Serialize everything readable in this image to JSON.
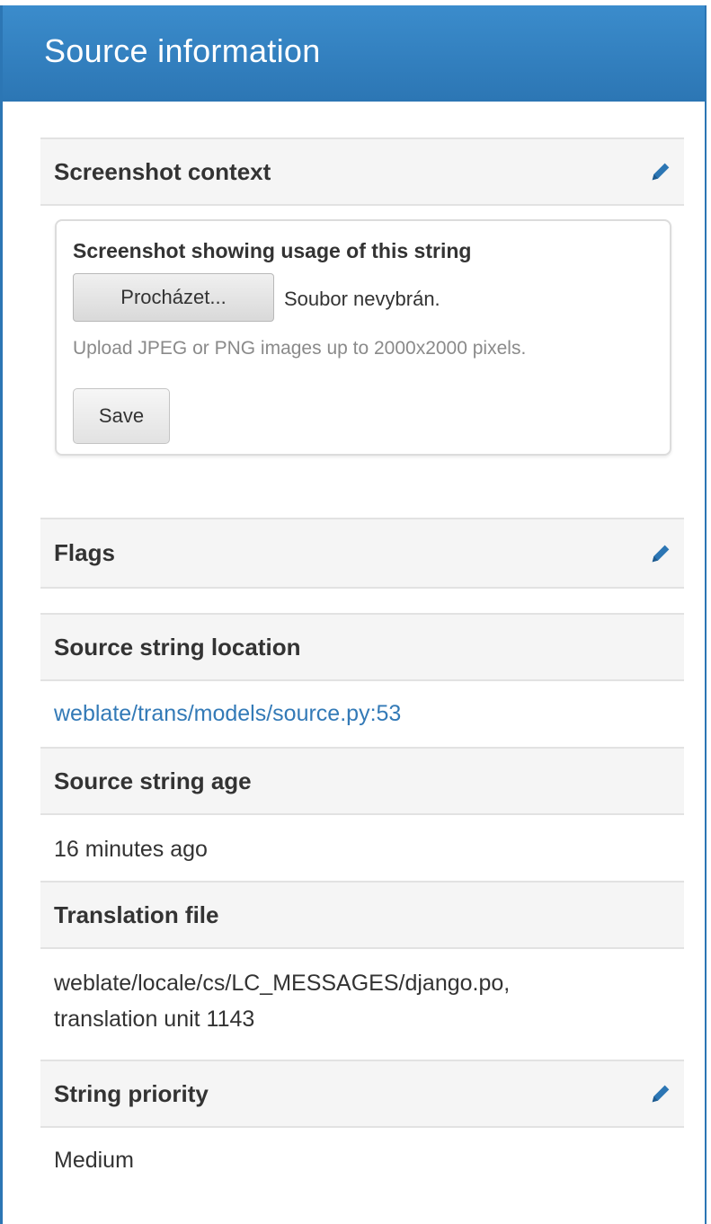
{
  "panel": {
    "title": "Source information"
  },
  "screenshot": {
    "header": "Screenshot context",
    "field_label": "Screenshot showing usage of this string",
    "browse_label": "Procházet...",
    "file_status": "Soubor nevybrán.",
    "help_text": "Upload JPEG or PNG images up to 2000x2000 pixels.",
    "save_label": "Save"
  },
  "flags": {
    "header": "Flags"
  },
  "location": {
    "header": "Source string location",
    "link_text": "weblate/trans/models/source.py:53"
  },
  "age": {
    "header": "Source string age",
    "value": "16 minutes ago"
  },
  "translation_file": {
    "header": "Translation file",
    "path": "weblate/locale/cs/LC_MESSAGES/django.po,",
    "unit": "translation unit 1143"
  },
  "priority": {
    "header": "String priority",
    "value": "Medium"
  },
  "colors": {
    "heading_blue": "#2c76b4",
    "link_blue": "#337ab7",
    "section_bg": "#f5f5f5"
  }
}
